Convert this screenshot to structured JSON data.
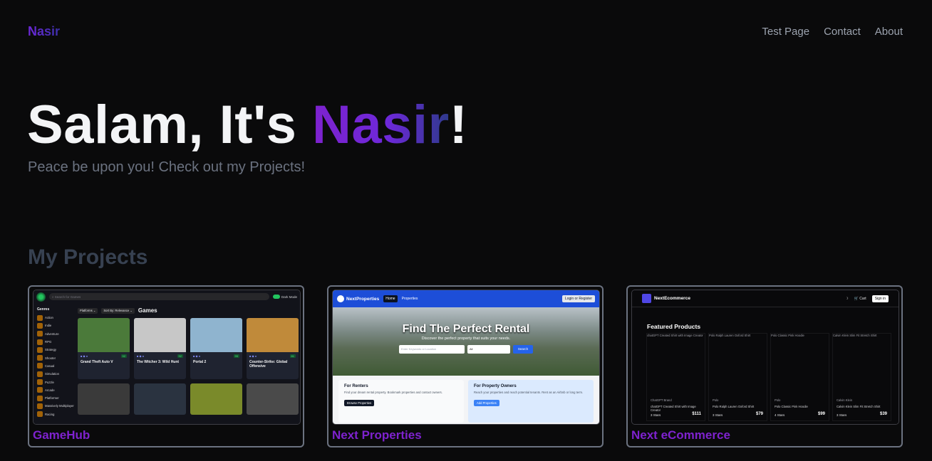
{
  "nav": {
    "brand": "Nasir",
    "links": [
      "Test Page",
      "Contact",
      "About"
    ]
  },
  "hero": {
    "title_prefix": "Salam, It's ",
    "title_name": "Nasir",
    "title_suffix": "!",
    "subtitle": "Peace be upon you! Check out my Projects!"
  },
  "projects": {
    "heading": "My Projects",
    "items": [
      {
        "title": "GameHub"
      },
      {
        "title": "Next Properties"
      },
      {
        "title": "Next eCommerce"
      }
    ]
  },
  "gamehub": {
    "search_placeholder": "Search for Games",
    "dark_mode": "Dark Mode",
    "genres_heading": "Genres",
    "genres": [
      "Action",
      "Indie",
      "Adventure",
      "RPG",
      "Strategy",
      "Shooter",
      "Casual",
      "Simulation",
      "Puzzle",
      "Arcade",
      "Platformer",
      "Massively Multiplayer",
      "Racing"
    ],
    "platforms_filter": "Platforms",
    "sort_filter": "Sort By: Relevance",
    "heading": "Games",
    "games": [
      {
        "name": "Grand Theft Auto V",
        "score": "92",
        "color": "#4b7a3a"
      },
      {
        "name": "The Witcher 3: Wild Hunt",
        "score": "92",
        "color": "#c7c7c7"
      },
      {
        "name": "Portal 2",
        "score": "95",
        "color": "#8fb4cf"
      },
      {
        "name": "Counter-Strike: Global Offensive",
        "score": "81",
        "color": "#c08a3a"
      }
    ],
    "second_row_colors": [
      "#3a3a3a",
      "#2a3340",
      "#7a8a2a",
      "#4a4a4a"
    ]
  },
  "nextprops": {
    "brand": "NextProperties",
    "nav_home": "Home",
    "nav_properties": "Properties",
    "login": "Login or Register",
    "hero_title": "Find The Perfect Rental",
    "hero_sub": "Discover the perfect property that suits your needs.",
    "search_placeholder": "Enter Keywords or Location",
    "select_value": "All",
    "search_button": "Search",
    "renters_title": "For Renters",
    "renters_text": "Find your dream rental property. Bookmark properties and contact owners.",
    "renters_button": "Browse Properties",
    "owners_title": "For Property Owners",
    "owners_text": "Reach your properties and reach potential tenants. Rent as an Airbnb or long term.",
    "owners_button": "Add Properties"
  },
  "nextecom": {
    "brand": "NextEcommerce",
    "cart": "Cart",
    "sign_in": "Sign in",
    "heading": "Featured Products",
    "products": [
      {
        "alt": "chatGPT Created Shirt with Image Creator",
        "brand": "ChatGPT Brand",
        "name": "chatGPT Created Shirt with Image Creator",
        "stars": "3 Stars",
        "price": "$111"
      },
      {
        "alt": "Polo Ralph Lauren Oxford Shirt",
        "brand": "Polo",
        "name": "Polo Ralph Lauren Oxford Shirt",
        "stars": "3 Stars",
        "price": "$79"
      },
      {
        "alt": "Polo Classic Pink Hoodie",
        "brand": "Polo",
        "name": "Polo Classic Pink Hoodie",
        "stars": "4 Stars",
        "price": "$99"
      },
      {
        "alt": "Calvin Klein Slim Fit Stretch Shirt",
        "brand": "Calvin Klein",
        "name": "Calvin Klein Slim Fit Stretch Shirt",
        "stars": "3 Stars",
        "price": "$39"
      }
    ]
  }
}
